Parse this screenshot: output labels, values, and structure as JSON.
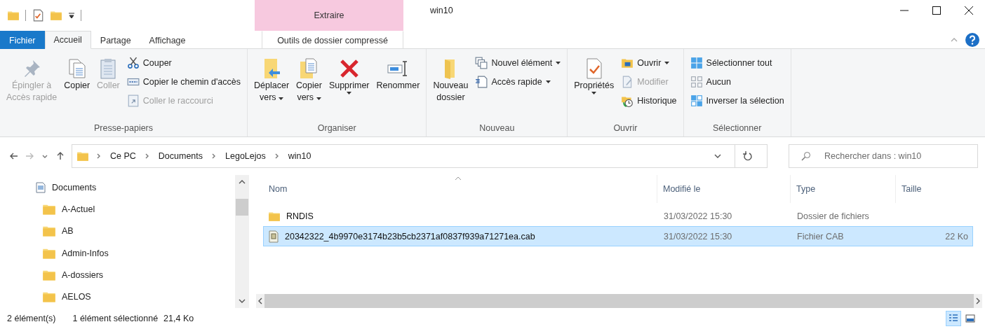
{
  "window": {
    "title": "win10",
    "context_tab_header": "Extraire"
  },
  "tabs": [
    {
      "label": "Fichier",
      "kind": "file-menu",
      "selected": false
    },
    {
      "label": "Accueil",
      "kind": "tab",
      "selected": true
    },
    {
      "label": "Partage",
      "kind": "tab",
      "selected": false
    },
    {
      "label": "Affichage",
      "kind": "tab",
      "selected": false
    },
    {
      "label": "Outils de dossier compressé",
      "kind": "context",
      "selected": false
    }
  ],
  "ribbon": {
    "groups": [
      {
        "label": "Presse-papiers",
        "sections": [
          {
            "kind": "large",
            "lines": [
              "Épingler à",
              "Accès rapide"
            ],
            "dropdown": false,
            "disabled": true
          },
          {
            "kind": "large",
            "lines": [
              "Copier"
            ],
            "dropdown": false,
            "disabled": false
          },
          {
            "kind": "large",
            "lines": [
              "Coller"
            ],
            "dropdown": false,
            "disabled": true
          },
          {
            "kind": "stack",
            "items": [
              {
                "label": "Couper",
                "dropdown": false,
                "disabled": false
              },
              {
                "label": "Copier le chemin d'accès",
                "dropdown": false,
                "disabled": false
              },
              {
                "label": "Coller le raccourci",
                "dropdown": false,
                "disabled": true
              }
            ]
          }
        ]
      },
      {
        "label": "Organiser",
        "sections": [
          {
            "kind": "large",
            "lines": [
              "Déplacer",
              "vers"
            ],
            "dropdown": true,
            "disabled": false
          },
          {
            "kind": "large",
            "lines": [
              "Copier",
              "vers"
            ],
            "dropdown": true,
            "disabled": false
          },
          {
            "kind": "large",
            "lines": [
              "Supprimer"
            ],
            "dropdown": true,
            "disabled": false
          },
          {
            "kind": "large",
            "lines": [
              "Renommer"
            ],
            "dropdown": false,
            "disabled": false
          }
        ]
      },
      {
        "label": "Nouveau",
        "sections": [
          {
            "kind": "large",
            "lines": [
              "Nouveau",
              "dossier"
            ],
            "dropdown": false,
            "disabled": false
          },
          {
            "kind": "stack",
            "items": [
              {
                "label": "Nouvel élément",
                "dropdown": true,
                "disabled": false
              },
              {
                "label": "Accès rapide",
                "dropdown": true,
                "disabled": false
              }
            ]
          }
        ]
      },
      {
        "label": "Ouvrir",
        "sections": [
          {
            "kind": "large",
            "lines": [
              "Propriétés"
            ],
            "dropdown": true,
            "disabled": false
          },
          {
            "kind": "stack",
            "items": [
              {
                "label": "Ouvrir",
                "dropdown": true,
                "disabled": false
              },
              {
                "label": "Modifier",
                "dropdown": false,
                "disabled": true
              },
              {
                "label": "Historique",
                "dropdown": false,
                "disabled": false
              }
            ]
          }
        ]
      },
      {
        "label": "Sélectionner",
        "sections": [
          {
            "kind": "stack",
            "items": [
              {
                "label": "Sélectionner tout",
                "dropdown": false,
                "disabled": false
              },
              {
                "label": "Aucun",
                "dropdown": false,
                "disabled": false
              },
              {
                "label": "Inverser la sélection",
                "dropdown": false,
                "disabled": false
              }
            ]
          }
        ]
      }
    ]
  },
  "address_bar": {
    "path": [
      "Ce PC",
      "Documents",
      "LegoLejos",
      "win10"
    ]
  },
  "search": {
    "placeholder": "Rechercher dans : win10"
  },
  "navigation": {
    "tree": [
      {
        "label": "Documents",
        "kind": "library",
        "children": [
          {
            "label": "A-Actuel",
            "kind": "folder"
          },
          {
            "label": "AB",
            "kind": "folder"
          },
          {
            "label": "Admin-Infos",
            "kind": "folder"
          },
          {
            "label": "A-dossiers",
            "kind": "folder"
          },
          {
            "label": "AELOS",
            "kind": "folder"
          }
        ]
      }
    ]
  },
  "file_list": {
    "columns": [
      "Nom",
      "Modifié le",
      "Type",
      "Taille"
    ],
    "rows": [
      {
        "kind": "folder",
        "name": "RNDIS",
        "modified": "31/03/2022 15:30",
        "type": "Dossier de fichiers",
        "selected": false
      },
      {
        "kind": "cab",
        "name": "20342322_4b9970e3174b23b5cb2371af0837f939a71271ea.cab",
        "modified": "31/03/2022 15:30",
        "type": "Fichier CAB",
        "size": "22 Ko",
        "selected": true
      }
    ]
  },
  "status_bar": {
    "count": "2 élément(s)",
    "selection": "1 élément sélectionné",
    "selection_size": "21,4 Ko",
    "views": [
      {
        "kind": "details",
        "selected": true
      },
      {
        "kind": "large-icons",
        "selected": false
      }
    ]
  }
}
